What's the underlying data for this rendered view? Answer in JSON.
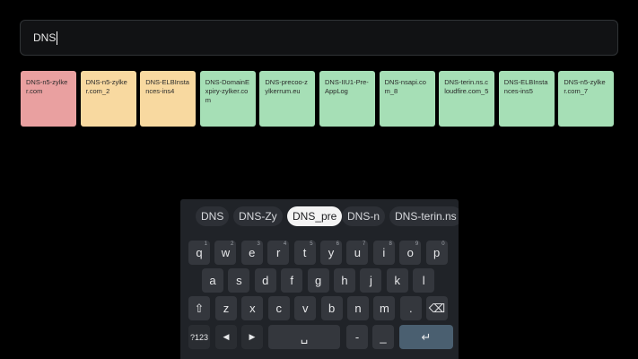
{
  "search": {
    "query": "DNS"
  },
  "tiles": [
    {
      "label": "DNS-n5-zylker.com",
      "color": "#e9a0a0"
    },
    {
      "label": "DNS-n5-zylker.com_2",
      "color": "#f8d9a0"
    },
    {
      "label": "DNS-ELBInstances-ins4",
      "color": "#f8d9a0"
    },
    {
      "label": "DNS-DomainExpiry-zylker.com",
      "color": "#a6dfb6"
    },
    {
      "label": "DNS-precoo-zylkerrum.eu",
      "color": "#a6dfb6"
    },
    {
      "label": "DNS-IIU1-Pre-AppLog",
      "color": "#a6dfb6"
    },
    {
      "label": "DNS-nsapi.com_8",
      "color": "#a6dfb6"
    },
    {
      "label": "DNS-terin.ns.cloudfire.com_5",
      "color": "#a6dfb6"
    },
    {
      "label": "DNS-ELBInstances-ins5",
      "color": "#a6dfb6"
    },
    {
      "label": "DNS-n5-zylker.com_7",
      "color": "#a6dfb6"
    }
  ],
  "keyboard": {
    "suggestions": [
      "DNS",
      "DNS-Zy",
      "DNS_pre",
      "DNS-n",
      "DNS-terin.ns"
    ],
    "row1": [
      {
        "k": "q",
        "h": "1"
      },
      {
        "k": "w",
        "h": "2"
      },
      {
        "k": "e",
        "h": "3"
      },
      {
        "k": "r",
        "h": "4"
      },
      {
        "k": "t",
        "h": "5"
      },
      {
        "k": "y",
        "h": "6"
      },
      {
        "k": "u",
        "h": "7"
      },
      {
        "k": "i",
        "h": "8"
      },
      {
        "k": "o",
        "h": "9"
      },
      {
        "k": "p",
        "h": "0"
      }
    ],
    "row2": [
      "a",
      "s",
      "d",
      "f",
      "g",
      "h",
      "j",
      "k",
      "l"
    ],
    "row3": [
      "z",
      "x",
      "c",
      "v",
      "b",
      "n",
      "m",
      "."
    ],
    "symbols_label": "?123",
    "dash_label": "-",
    "underscore_label": "_"
  },
  "colors": {
    "accent": "#4a5f70",
    "keyboard_bg": "#202328"
  }
}
